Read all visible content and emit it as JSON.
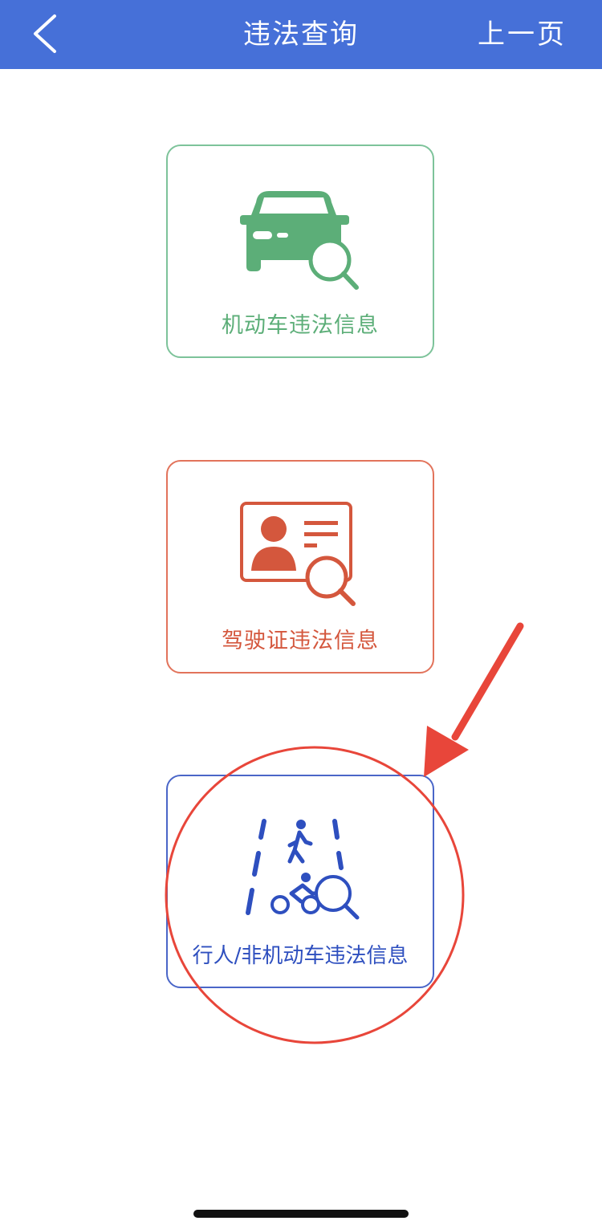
{
  "nav": {
    "title": "违法查询",
    "prev_label": "上一页",
    "back_icon": "chevron-left-icon",
    "background": "#4670D8"
  },
  "cards": [
    {
      "id": "vehicle",
      "label": "机动车违法信息",
      "icon": "car-search-icon",
      "color": "#5CAE78"
    },
    {
      "id": "license",
      "label": "驾驶证违法信息",
      "icon": "id-card-search-icon",
      "color": "#D4573D"
    },
    {
      "id": "pedestrian",
      "label": "行人/非机动车违法信息",
      "icon": "pedestrian-cyclist-search-icon",
      "color": "#2E4FBF"
    }
  ],
  "annotation": {
    "highlight_color": "#E8463A",
    "shapes": [
      "red-circle",
      "red-arrow"
    ]
  }
}
